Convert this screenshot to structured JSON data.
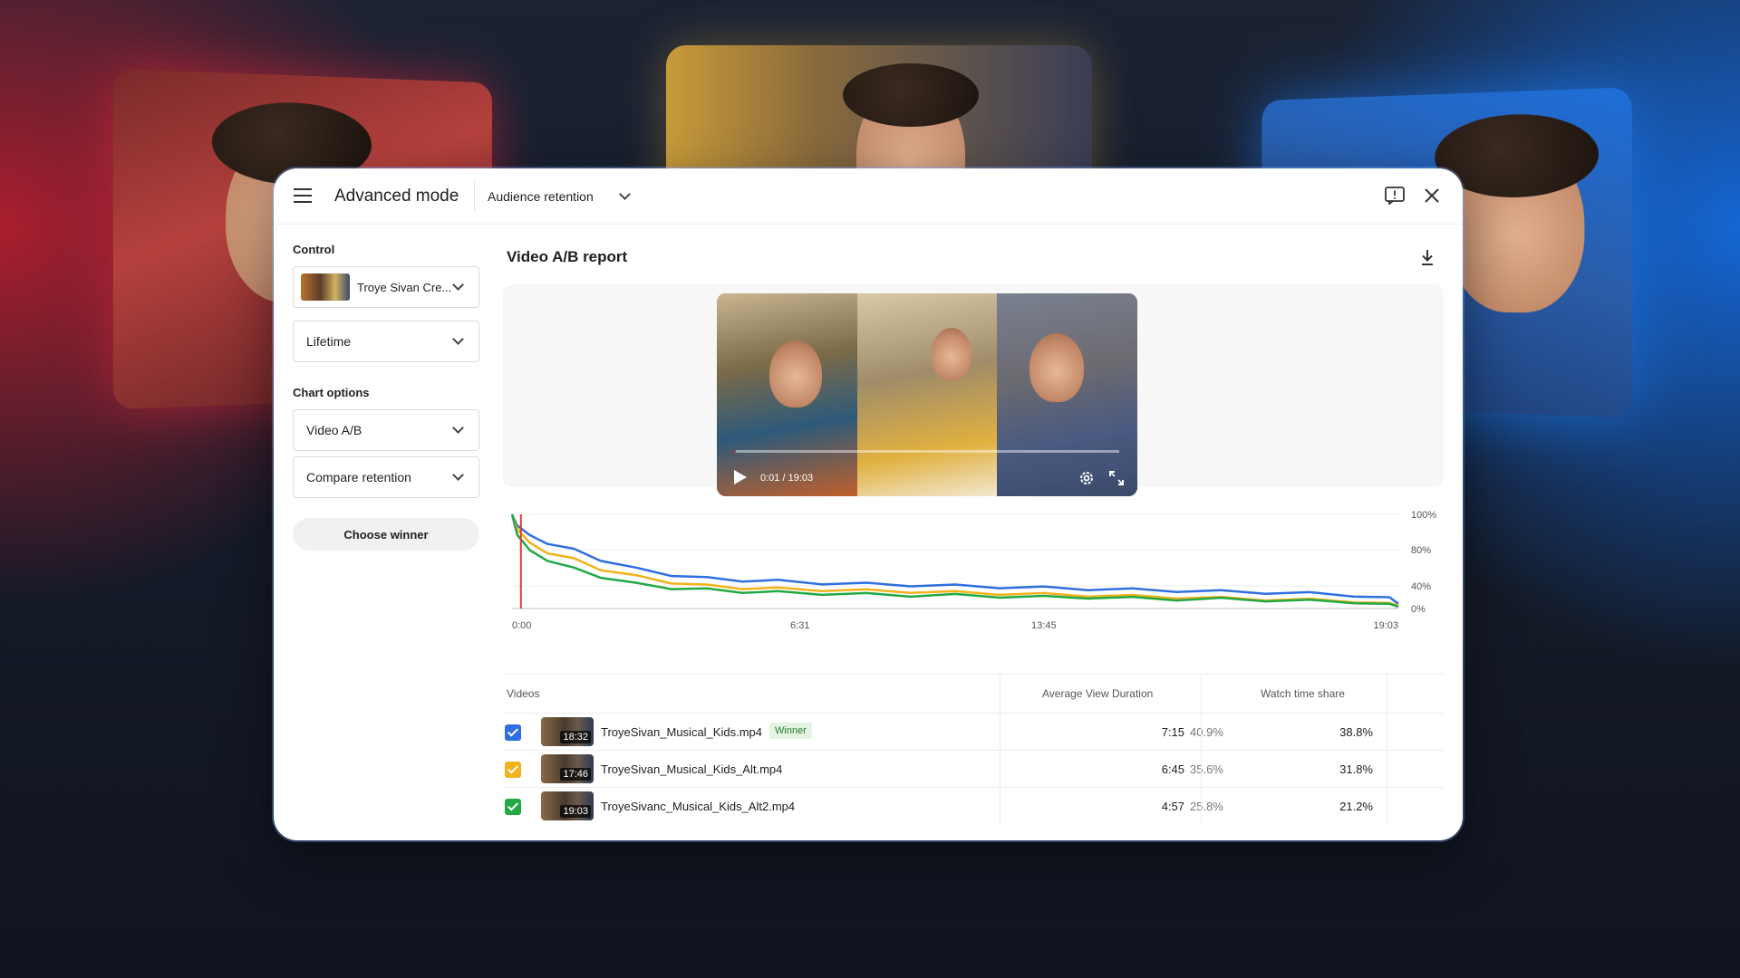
{
  "header": {
    "title": "Advanced mode",
    "report_select": "Audience retention"
  },
  "sidebar": {
    "control_label": "Control",
    "video_select": "Troye Sivan Cre...",
    "period_select": "Lifetime",
    "chart_options_label": "Chart options",
    "chart_type_select": "Video A/B",
    "metric_select": "Compare retention",
    "choose_winner_label": "Choose winner"
  },
  "report": {
    "title": "Video A/B report",
    "player": {
      "time": "0:01 / 19:03",
      "progress": 0.001
    }
  },
  "chart_data": {
    "type": "line",
    "x_ticks": [
      "0:00",
      "6:31",
      "13:45",
      "19:03"
    ],
    "y_ticks": [
      "100%",
      "80%",
      "40%",
      "0%"
    ],
    "ylim": [
      0,
      100
    ],
    "grid": true,
    "cursor_x": 0.01,
    "series": [
      {
        "color": "#2f6fe0",
        "x": [
          0,
          0.006,
          0.02,
          0.04,
          0.07,
          0.1,
          0.14,
          0.18,
          0.22,
          0.26,
          0.3,
          0.35,
          0.4,
          0.45,
          0.5,
          0.55,
          0.6,
          0.65,
          0.7,
          0.75,
          0.8,
          0.85,
          0.9,
          0.95,
          0.99,
          1.0
        ],
        "y": [
          100,
          88,
          78,
          70,
          62,
          52,
          42,
          36,
          32,
          30,
          29,
          27,
          26,
          25,
          24,
          23,
          22,
          21,
          20,
          19,
          18,
          17,
          16,
          14,
          12,
          5
        ]
      },
      {
        "color": "#f2b21a",
        "x": [
          0,
          0.006,
          0.02,
          0.04,
          0.07,
          0.1,
          0.14,
          0.18,
          0.22,
          0.26,
          0.3,
          0.35,
          0.4,
          0.45,
          0.5,
          0.55,
          0.6,
          0.65,
          0.7,
          0.75,
          0.8,
          0.85,
          0.9,
          0.95,
          0.99,
          1.0
        ],
        "y": [
          100,
          84,
          70,
          60,
          52,
          42,
          34,
          28,
          24,
          22,
          21,
          20,
          19,
          18,
          17,
          16,
          15,
          14,
          13,
          12,
          11,
          10,
          9,
          8,
          6,
          3
        ]
      },
      {
        "color": "#22a845",
        "x": [
          0,
          0.006,
          0.02,
          0.04,
          0.07,
          0.1,
          0.14,
          0.18,
          0.22,
          0.26,
          0.3,
          0.35,
          0.4,
          0.45,
          0.5,
          0.55,
          0.6,
          0.65,
          0.7,
          0.75,
          0.8,
          0.85,
          0.9,
          0.95,
          0.99,
          1.0
        ],
        "y": [
          100,
          78,
          62,
          52,
          42,
          34,
          26,
          22,
          20,
          18,
          17,
          16,
          15,
          14,
          14,
          13,
          12,
          12,
          11,
          10,
          10,
          9,
          8,
          7,
          5,
          2
        ]
      }
    ]
  },
  "table": {
    "headers": {
      "videos": "Videos",
      "avd": "Average View Duration",
      "share": "Watch time share"
    },
    "winner_label": "Winner",
    "rows": [
      {
        "checkbox_color": "#2f6fe0",
        "duration": "18:32",
        "name": "TroyeSivan_Musical_Kids.mp4",
        "winner": true,
        "avd": "7:15",
        "avd_pct": "40.9%",
        "share": "38.8%"
      },
      {
        "checkbox_color": "#f2b21a",
        "duration": "17:46",
        "name": "TroyeSivan_Musical_Kids_Alt.mp4",
        "winner": false,
        "avd": "6:45",
        "avd_pct": "35.6%",
        "share": "31.8%"
      },
      {
        "checkbox_color": "#22a845",
        "duration": "19:03",
        "name": "TroyeSivanc_Musical_Kids_Alt2.mp4",
        "winner": false,
        "avd": "4:57",
        "avd_pct": "25.8%",
        "share": "21.2%"
      }
    ]
  }
}
